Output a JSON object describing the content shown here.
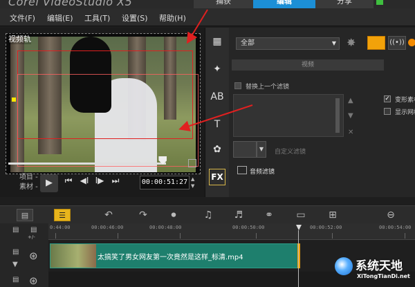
{
  "app": {
    "title": "Corel VideoStudio X5"
  },
  "steps": {
    "capture": "捕获",
    "edit": "编辑",
    "share": "分享"
  },
  "menu": {
    "file": "文件(F)",
    "edit": "编辑(E)",
    "tools": "工具(T)",
    "settings": "设置(S)",
    "help": "帮助(H)"
  },
  "preview": {
    "track_label": "视频轨",
    "mode_project": "项目 -",
    "mode_clip": "素材 -",
    "timecode": "00:00:51:27",
    "scrub_progress": 0.98
  },
  "library": {
    "category": "全部",
    "options_header": "视频",
    "replace_last_filter": "替换上一个滤镜",
    "custom_filter": "自定义滤镜",
    "audio_filter": "音频滤镜",
    "deform_clip": "变形素材",
    "show_grid": "显示网格",
    "deform_checked": true,
    "show_grid_checked": false,
    "fx_label": "FX"
  },
  "ruler": {
    "ticks": [
      "0:44:00",
      "00:00:46:00",
      "00:00:48:00",
      "00:00:50:00",
      "00:00:52:00",
      "00:00:54:00"
    ]
  },
  "timeline": {
    "clip_title": "太搞笑了男女网友第一次竟然是这样_标清.mp4"
  },
  "watermark": {
    "title": "系统天地",
    "url": "XiTongTianDi.net"
  },
  "colors": {
    "accent_blue": "#1c8fd6",
    "clip_teal": "#1e7f6d",
    "selection_red": "#e02020",
    "highlight_orange": "#f2a20a"
  }
}
